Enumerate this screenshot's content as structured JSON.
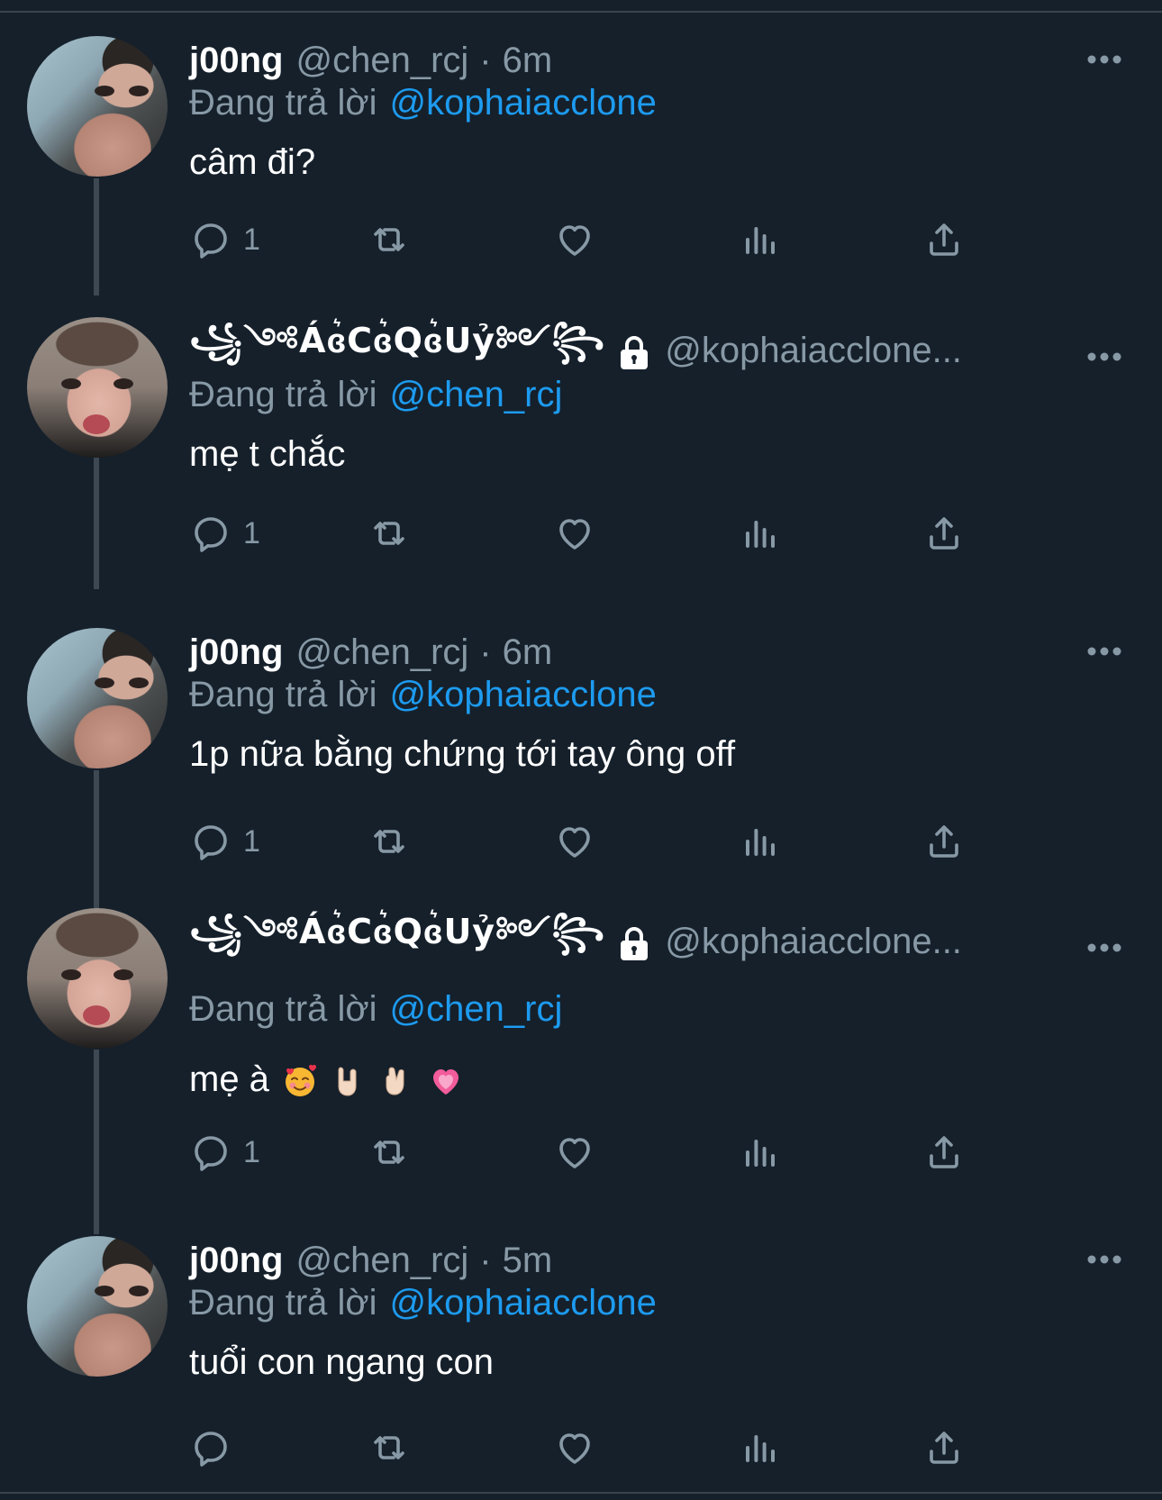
{
  "tweets": [
    {
      "display_name": "j00ng",
      "handle": "@chen_rcj",
      "separator": "·",
      "time": "6m",
      "reply_prefix": "Đang trả lời",
      "reply_mention": "@kophaiacclone",
      "text": "câm đi?",
      "reply_count": "1",
      "avatar": "avatar-joong"
    },
    {
      "display_name": "꧁༺Áɞ͛Cɞ͛Qɞ͛Uỷ༻꧂",
      "locked": true,
      "handle": "@kophaiacclone...",
      "reply_prefix": "Đang trả lời",
      "reply_mention": "@chen_rcj",
      "text": "mẹ t chắc",
      "reply_count": "1",
      "avatar": "avatar-kophaiacclone"
    },
    {
      "display_name": "j00ng",
      "handle": "@chen_rcj",
      "separator": "·",
      "time": "6m",
      "reply_prefix": "Đang trả lời",
      "reply_mention": "@kophaiacclone",
      "text": "1p nữa bằng chứng tới tay ông off",
      "reply_count": "1",
      "avatar": "avatar-joong"
    },
    {
      "display_name": "꧁༺Áɞ͛Cɞ͛Qɞ͛Uỷ༻꧂",
      "locked": true,
      "handle": "@kophaiacclone...",
      "reply_prefix": "Đang trả lời",
      "reply_mention": "@chen_rcj",
      "text": "mẹ à",
      "emojis": [
        "smiling-face-with-hearts",
        "sign-of-horns",
        "crossed-fingers",
        "growing-heart"
      ],
      "reply_count": "1",
      "avatar": "avatar-kophaiacclone"
    },
    {
      "display_name": "j00ng",
      "handle": "@chen_rcj",
      "separator": "·",
      "time": "5m",
      "reply_prefix": "Đang trả lời",
      "reply_mention": "@kophaiacclone",
      "text": "tuổi con ngang con",
      "reply_count": "",
      "avatar": "avatar-joong"
    }
  ],
  "icons": {
    "reply": "reply-bubble-icon",
    "retweet": "retweet-icon",
    "like": "heart-icon",
    "views": "views-bar-chart-icon",
    "share": "share-upload-icon",
    "more": "more-ellipsis-icon",
    "lock": "lock-icon"
  },
  "colors": {
    "background": "#15202b",
    "secondary_text": "#8899a6",
    "mention": "#1d9bf0",
    "divider": "#38444d"
  }
}
